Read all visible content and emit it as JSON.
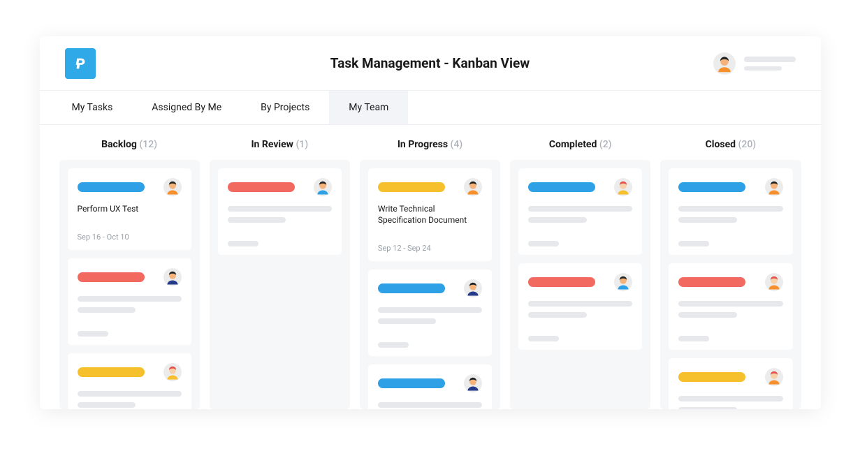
{
  "header": {
    "title": "Task Management - Kanban View"
  },
  "tabs": [
    {
      "label": "My Tasks",
      "active": false
    },
    {
      "label": "Assigned By Me",
      "active": false
    },
    {
      "label": "By Projects",
      "active": false
    },
    {
      "label": "My Team",
      "active": true
    }
  ],
  "colors": {
    "blue": "#2ea0e6",
    "red": "#f26a5f",
    "yellow": "#f6c02d"
  },
  "avatars": {
    "orange_afro": {
      "skin": "#f5b27a",
      "hair": "#222",
      "shirt": "#f6902d"
    },
    "blue_bob": {
      "skin": "#f5b27a",
      "hair": "#222",
      "shirt": "#2ea0e6"
    },
    "navy_bun": {
      "skin": "#f5b27a",
      "hair": "#222",
      "shirt": "#263a8a"
    },
    "red_pony": {
      "skin": "#f5d0a8",
      "hair": "#e1504a",
      "shirt": "#f6c02d"
    },
    "red_bob": {
      "skin": "#f5d0a8",
      "hair": "#e1504a",
      "shirt": "#f6902d"
    }
  },
  "columns": [
    {
      "title": "Backlog",
      "count": "(12)",
      "cards": [
        {
          "pill": "blue",
          "avatar": "orange_afro",
          "title": "Perform UX Test",
          "dates": "Sep 16 - Oct 10",
          "placeholder_body": false,
          "placeholder_footer": false
        },
        {
          "pill": "red",
          "avatar": "navy_bun",
          "placeholder_body": true,
          "placeholder_footer": true
        },
        {
          "pill": "yellow",
          "avatar": "red_pony",
          "placeholder_body": true,
          "placeholder_footer": false
        }
      ]
    },
    {
      "title": "In Review",
      "count": "(1)",
      "cards": [
        {
          "pill": "red",
          "avatar": "blue_bob",
          "placeholder_body": true,
          "placeholder_footer": true
        }
      ]
    },
    {
      "title": "In Progress",
      "count": "(4)",
      "cards": [
        {
          "pill": "yellow",
          "avatar": "orange_afro",
          "title": "Write Technical Specification Document",
          "dates": "Sep 12 - Sep 24",
          "placeholder_body": false,
          "placeholder_footer": false
        },
        {
          "pill": "blue",
          "avatar": "navy_bun",
          "placeholder_body": true,
          "placeholder_footer": true
        },
        {
          "pill": "blue",
          "avatar": "navy_bun",
          "placeholder_body": true,
          "placeholder_footer": false
        }
      ]
    },
    {
      "title": "Completed",
      "count": "(2)",
      "cards": [
        {
          "pill": "blue",
          "avatar": "red_pony",
          "placeholder_body": true,
          "placeholder_footer": true
        },
        {
          "pill": "red",
          "avatar": "blue_bob",
          "placeholder_body": true,
          "placeholder_footer": true
        }
      ]
    },
    {
      "title": "Closed",
      "count": "(20)",
      "cards": [
        {
          "pill": "blue",
          "avatar": "orange_afro",
          "placeholder_body": true,
          "placeholder_footer": true
        },
        {
          "pill": "red",
          "avatar": "red_bob",
          "placeholder_body": true,
          "placeholder_footer": true
        },
        {
          "pill": "yellow",
          "avatar": "red_bob",
          "placeholder_body": true,
          "placeholder_footer": false
        }
      ]
    }
  ]
}
